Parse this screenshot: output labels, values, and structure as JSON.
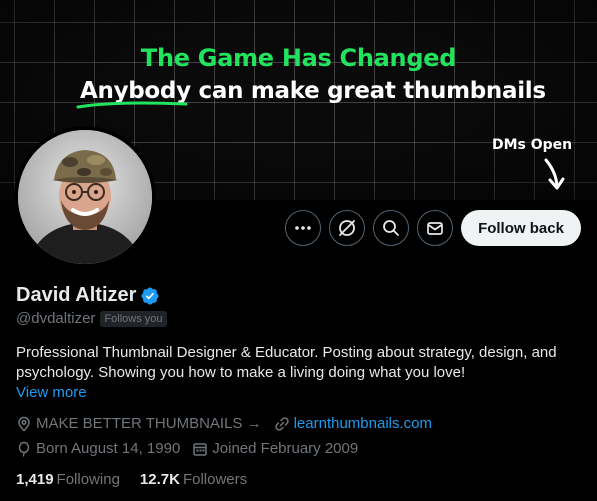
{
  "banner": {
    "headline": "The Game Has Changed",
    "sub_highlight": "Anybody",
    "sub_rest": " can make great thumbnails",
    "dm_note": "DMs Open",
    "accent_color": "#22e35d"
  },
  "actions": {
    "more_icon": "more-icon",
    "grok_icon": "grok-icon",
    "search_icon": "search-icon",
    "message_icon": "message-icon",
    "follow_label": "Follow back"
  },
  "profile": {
    "name": "David Altizer",
    "verified_icon": "verified-badge-icon",
    "handle": "@dvdaltizer",
    "follows_you": "Follows you",
    "bio_line1": "Professional Thumbnail Designer & Educator. Posting about strategy, design, and",
    "bio_line2": "psychology. Showing you how to make a living doing what you love!",
    "view_more": "View more",
    "category": "MAKE BETTER THUMBNAILS →",
    "website": "learnthumbnails.com",
    "born": "Born August 14, 1990",
    "joined": "Joined February 2009"
  },
  "stats": {
    "following_count": "1,419",
    "following_label": "Following",
    "followers_count": "12.7K",
    "followers_label": "Followers"
  },
  "colors": {
    "link": "#1d9bf0",
    "muted": "#71767b",
    "text": "#e7e9ea",
    "verified": "#1d9bf0"
  }
}
